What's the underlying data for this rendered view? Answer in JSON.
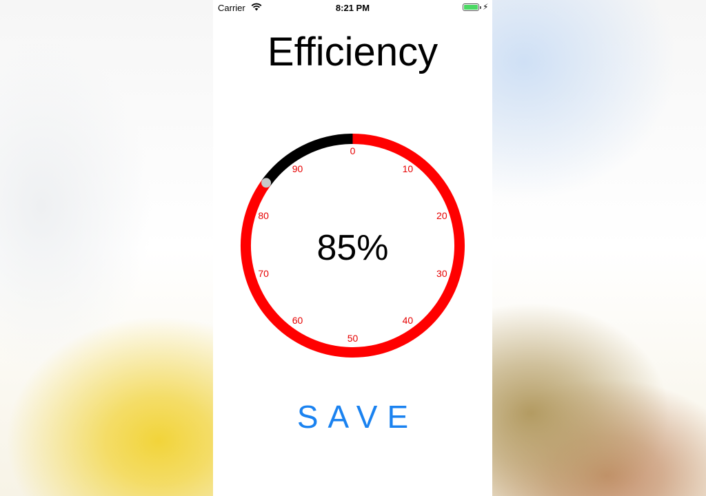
{
  "status_bar": {
    "carrier": "Carrier",
    "time": "8:21 PM",
    "battery_level": 1.0,
    "battery_color": "#4cd964",
    "icons": [
      "wifi-icon",
      "battery-icon",
      "charging-bolt-icon"
    ]
  },
  "screen": {
    "title": "Efficiency",
    "readout": "85%",
    "save_label": "SAVE"
  },
  "gauge": {
    "value_percent": 85,
    "tick_labels": [
      "0",
      "10",
      "20",
      "30",
      "40",
      "50",
      "60",
      "70",
      "80",
      "90"
    ],
    "track_color": "#ff0000",
    "remainder_color": "#000000",
    "label_color": "#e60000",
    "handle_color": "#c8c8c8"
  },
  "colors": {
    "accent": "#1a82f0"
  }
}
